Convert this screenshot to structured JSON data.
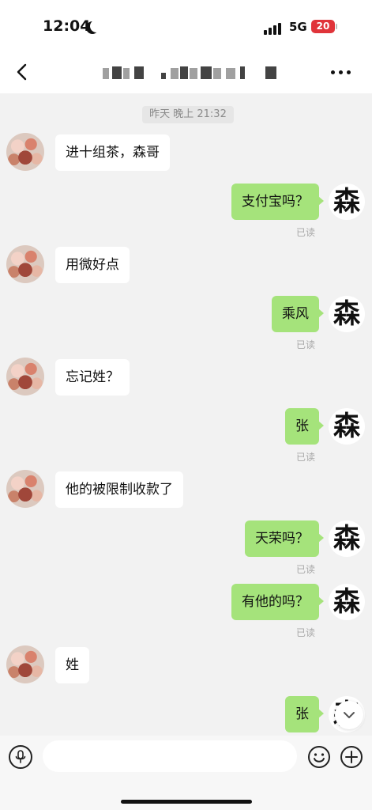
{
  "status_bar": {
    "time": "12:04",
    "network": "5G",
    "battery": "20"
  },
  "chat": {
    "time_divider": "昨天 晚上 21:32",
    "messages": [
      {
        "from": "peer",
        "text": "进十组茶，森哥"
      },
      {
        "from": "self",
        "text": "支付宝吗？",
        "status": "已读"
      },
      {
        "from": "peer",
        "text": "用微好点"
      },
      {
        "from": "self",
        "text": "乘风",
        "status": "已读"
      },
      {
        "from": "peer",
        "text": "忘记姓？"
      },
      {
        "from": "self",
        "text": "张",
        "status": "已读"
      },
      {
        "from": "peer",
        "text": "他的被限制收款了"
      },
      {
        "from": "self",
        "text": "天荣吗？",
        "status": "已读"
      },
      {
        "from": "self",
        "text": "有他的吗？",
        "status": "已读"
      },
      {
        "from": "peer",
        "text": "姓"
      },
      {
        "from": "self",
        "text": "张"
      }
    ],
    "self_avatar_glyph": "森"
  },
  "input": {
    "placeholder": ""
  },
  "colors": {
    "self_bubble": "#a5e37b",
    "peer_bubble": "#ffffff",
    "background": "#f2f2f2",
    "battery_low": "#e0343a"
  },
  "icons": [
    "chevron-left-icon",
    "more-icon",
    "microphone-icon",
    "emoji-icon",
    "plus-icon",
    "chevron-down-icon",
    "moon-icon",
    "signal-icon"
  ]
}
